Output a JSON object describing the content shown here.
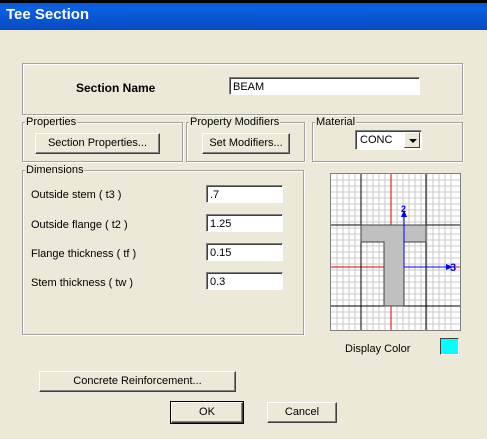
{
  "window": {
    "title": "Tee Section"
  },
  "section": {
    "label": "Section Name",
    "value": "BEAM"
  },
  "properties": {
    "group_label": "Properties",
    "button_label": "Section Properties..."
  },
  "modifiers": {
    "group_label": "Property Modifiers",
    "button_label": "Set Modifiers..."
  },
  "material": {
    "group_label": "Material",
    "selected": "CONC"
  },
  "dimensions": {
    "group_label": "Dimensions",
    "fields": [
      {
        "label": "Outside stem  ( t3 )",
        "value": ".7"
      },
      {
        "label": "Outside flange  ( t2 )",
        "value": "1.25"
      },
      {
        "label": "Flange thickness  ( tf )",
        "value": "0.15"
      },
      {
        "label": "Stem thickness  ( tw )",
        "value": "0.3"
      }
    ]
  },
  "preview": {
    "axis_2_label": "2",
    "axis_3_label": "3"
  },
  "display_color": {
    "label": "Display Color",
    "color": "#00ffff"
  },
  "reinforcement": {
    "button_label": "Concrete Reinforcement..."
  },
  "actions": {
    "ok_label": "OK",
    "cancel_label": "Cancel"
  }
}
